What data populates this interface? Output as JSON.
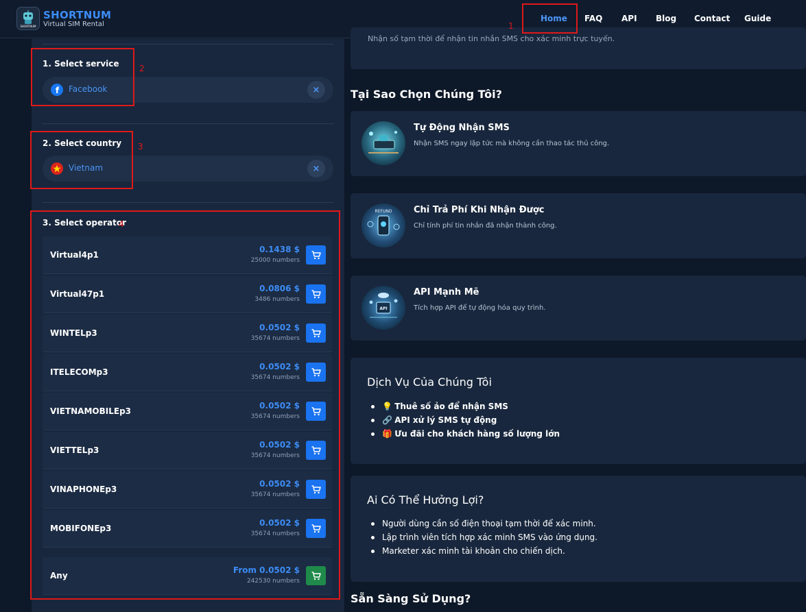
{
  "brand": {
    "name": "SHORTNUM",
    "tagline": "Virtual SIM Rental",
    "logo_text": "SHORTNUM"
  },
  "nav": [
    {
      "label": "Home",
      "active": true
    },
    {
      "label": "FAQ"
    },
    {
      "label": "API"
    },
    {
      "label": "Blog"
    },
    {
      "label": "Contact"
    },
    {
      "label": "Guide"
    }
  ],
  "annotations": [
    "1",
    "2",
    "3",
    "4"
  ],
  "service": {
    "title": "1. Select service",
    "selected": "Facebook",
    "icon": "facebook-icon",
    "clear": "×"
  },
  "country": {
    "title": "2. Select country",
    "selected": "Vietnam",
    "icon": "vietnam-flag-icon",
    "clear": "×"
  },
  "operator": {
    "title": "3. Select operator",
    "rows": [
      {
        "name": "Virtual4p1",
        "price": "0.1438 $",
        "count": "25000 numbers"
      },
      {
        "name": "Virtual47p1",
        "price": "0.0806 $",
        "count": "3486 numbers"
      },
      {
        "name": "WINTELp3",
        "price": "0.0502 $",
        "count": "35674 numbers"
      },
      {
        "name": "ITELECOMp3",
        "price": "0.0502 $",
        "count": "35674 numbers"
      },
      {
        "name": "VIETNAMOBILEp3",
        "price": "0.0502 $",
        "count": "35674 numbers"
      },
      {
        "name": "VIETTELp3",
        "price": "0.0502 $",
        "count": "35674 numbers"
      },
      {
        "name": "VINAPHONEp3",
        "price": "0.0502 $",
        "count": "35674 numbers"
      },
      {
        "name": "MOBIFONEp3",
        "price": "0.0502 $",
        "count": "35674 numbers"
      }
    ],
    "any": {
      "name": "Any",
      "price": "From 0.0502 $",
      "count": "242530 numbers"
    }
  },
  "intro_cut_text": "Nhận số tạm thời để nhận tin nhắn SMS cho xác minh trực tuyến.",
  "why": {
    "heading": "Tại Sao Chọn Chúng Tôi?",
    "features": [
      {
        "title": "Tự Động Nhận SMS",
        "desc": "Nhận SMS ngay lập tức mà không cần thao tác thủ công."
      },
      {
        "title": "Chỉ Trả Phí Khi Nhận Được",
        "desc": "Chỉ tính phí tin nhắn đã nhận thành công.",
        "badge": "REFUND"
      },
      {
        "title": "API Mạnh Mẽ",
        "desc": "Tích hợp API để tự động hóa quy trình.",
        "badge": "API"
      }
    ]
  },
  "services": {
    "title": "Dịch Vụ Của Chúng Tôi",
    "items": [
      {
        "emoji": "💡",
        "text": "Thuê số ảo để nhận SMS"
      },
      {
        "emoji": "🔗",
        "text": "API xử lý SMS tự động"
      },
      {
        "emoji": "🎁",
        "text": "Ưu đãi cho khách hàng số lượng lớn"
      }
    ]
  },
  "benefit": {
    "title": "Ai Có Thể Hưởng Lợi?",
    "items": [
      "Người dùng cần số điện thoại tạm thời để xác minh.",
      "Lập trình viên tích hợp xác minh SMS vào ứng dụng.",
      "Marketer xác minh tài khoản cho chiến dịch."
    ]
  },
  "ready": {
    "heading": "Sẵn Sàng Sử Dụng?"
  }
}
